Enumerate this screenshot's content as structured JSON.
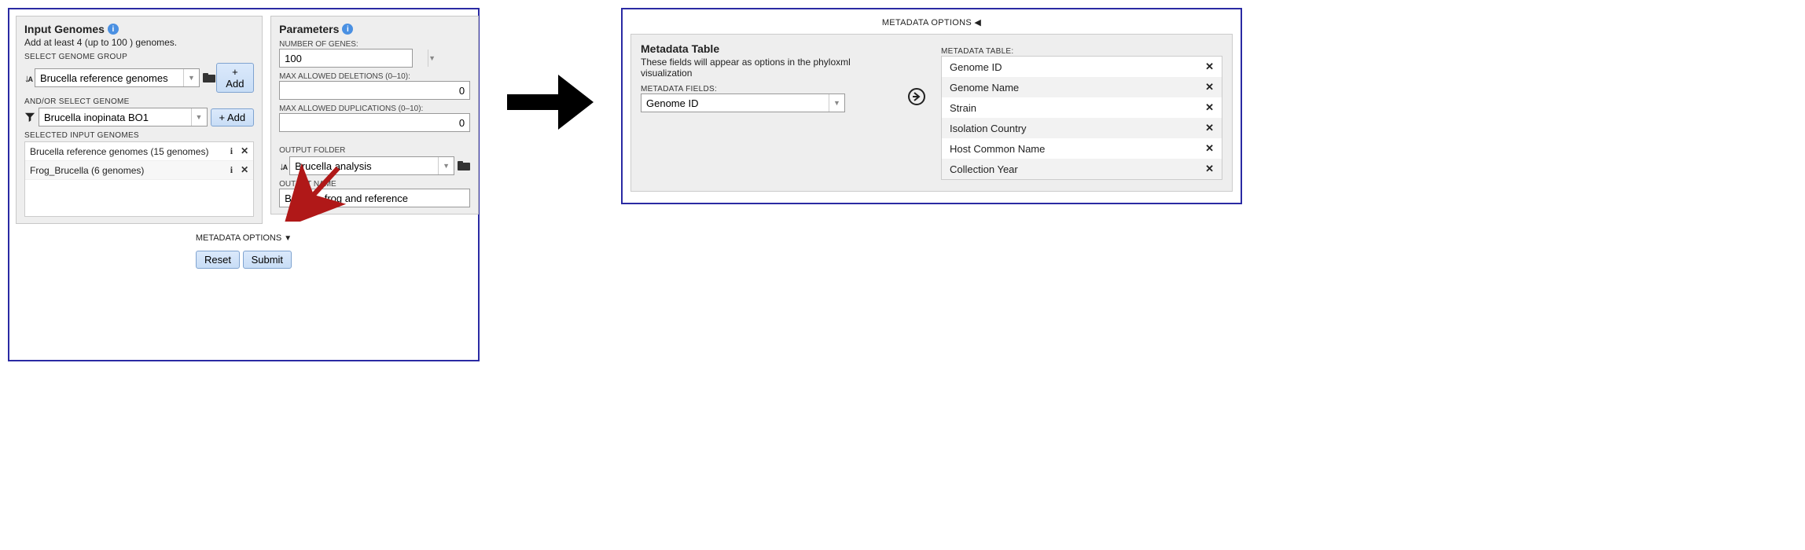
{
  "left": {
    "input_genomes": {
      "title": "Input Genomes",
      "hint": "Add at least 4 (up to 100 ) genomes.",
      "select_group_label": "SELECT GENOME GROUP",
      "genome_group_value": "Brucella reference genomes",
      "andor_label": "AND/OR SELECT GENOME",
      "genome_value": "Brucella inopinata BO1",
      "add_label": "+ Add",
      "selected_label": "SELECTED INPUT GENOMES",
      "rows": [
        {
          "label": "Brucella reference genomes (15 genomes)"
        },
        {
          "label": "Frog_Brucella (6 genomes)"
        }
      ]
    },
    "parameters": {
      "title": "Parameters",
      "num_genes_label": "NUMBER OF GENES:",
      "num_genes_value": "100",
      "max_del_label": "MAX ALLOWED DELETIONS (0–10):",
      "max_del_value": "0",
      "max_dup_label": "MAX ALLOWED DUPLICATIONS (0–10):",
      "max_dup_value": "0",
      "output_folder_label": "OUTPUT FOLDER",
      "output_folder_value": "Brucella analysis",
      "output_name_label": "OUTPUT NAME",
      "output_name_value": "Brucella frog and reference"
    },
    "meta_toggle": "METADATA OPTIONS",
    "reset_label": "Reset",
    "submit_label": "Submit"
  },
  "right": {
    "header": "METADATA OPTIONS",
    "table_title": "Metadata Table",
    "table_desc": "These fields will appear as options in the phyloxml visualization",
    "fields_label": "METADATA FIELDS:",
    "field_value": "Genome ID",
    "list_label": "METADATA TABLE:",
    "rows": [
      {
        "label": "Genome ID"
      },
      {
        "label": "Genome Name"
      },
      {
        "label": "Strain"
      },
      {
        "label": "Isolation Country"
      },
      {
        "label": "Host Common Name"
      },
      {
        "label": "Collection Year"
      }
    ]
  }
}
